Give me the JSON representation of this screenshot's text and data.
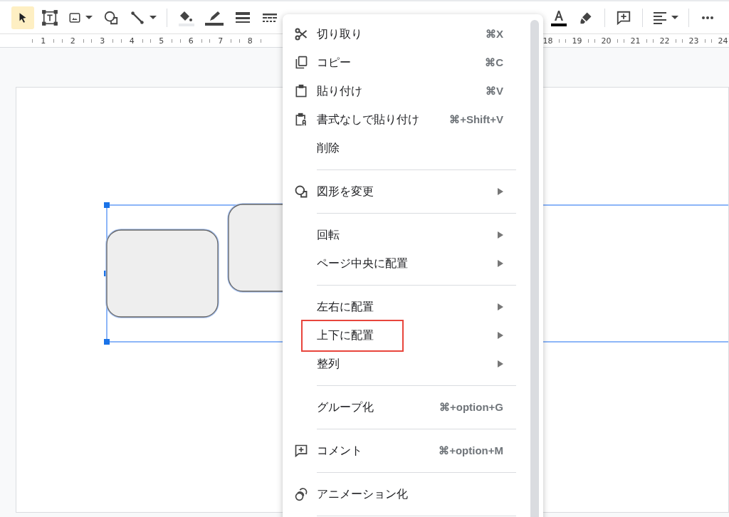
{
  "toolbar": {
    "tools": [
      {
        "kind": "select",
        "selected": true
      },
      {
        "kind": "textbox",
        "selected": false
      },
      {
        "kind": "image",
        "selected": false
      },
      {
        "kind": "shape",
        "selected": false
      },
      {
        "kind": "line",
        "selected": false
      },
      {
        "kind": "divider"
      },
      {
        "kind": "fill",
        "selected": false
      },
      {
        "kind": "border-color",
        "selected": false
      },
      {
        "kind": "border-weight",
        "selected": false
      },
      {
        "kind": "border-dash",
        "selected": false
      }
    ],
    "right_tools": [
      {
        "kind": "text-color",
        "selected": false
      },
      {
        "kind": "highlight",
        "selected": false
      },
      {
        "kind": "divider"
      },
      {
        "kind": "comment",
        "selected": false
      },
      {
        "kind": "divider"
      },
      {
        "kind": "align",
        "selected": false
      },
      {
        "kind": "divider"
      },
      {
        "kind": "more",
        "selected": false
      }
    ]
  },
  "ruler": {
    "left_numbers": [
      "1",
      "2",
      "3",
      "4",
      "5",
      "6",
      "7",
      "8"
    ],
    "right_numbers": [
      "18",
      "19",
      "20",
      "21",
      "22",
      "23",
      "24"
    ]
  },
  "slide": {
    "shapes": [
      {
        "kind": "rounded-rect",
        "selected": true
      },
      {
        "kind": "rounded-rect",
        "selected": true
      }
    ]
  },
  "context_menu": {
    "items": [
      {
        "kind": "item",
        "label": "切り取り",
        "shortcut": "⌘X",
        "submenu": false,
        "highlighted": false
      },
      {
        "kind": "item",
        "label": "コピー",
        "shortcut": "⌘C",
        "submenu": false,
        "highlighted": false
      },
      {
        "kind": "item",
        "label": "貼り付け",
        "shortcut": "⌘V",
        "submenu": false,
        "highlighted": false
      },
      {
        "kind": "item",
        "label": "書式なしで貼り付け",
        "shortcut": "⌘+Shift+V",
        "submenu": false,
        "highlighted": false
      },
      {
        "kind": "item",
        "label": "削除",
        "submenu": false,
        "highlighted": false
      },
      {
        "kind": "separator"
      },
      {
        "kind": "item",
        "label": "図形を変更",
        "submenu": true,
        "highlighted": false
      },
      {
        "kind": "separator"
      },
      {
        "kind": "item",
        "label": "回転",
        "submenu": true,
        "highlighted": false
      },
      {
        "kind": "item",
        "label": "ページ中央に配置",
        "submenu": true,
        "highlighted": false
      },
      {
        "kind": "separator"
      },
      {
        "kind": "item",
        "label": "左右に配置",
        "submenu": true,
        "highlighted": false
      },
      {
        "kind": "item",
        "label": "上下に配置",
        "submenu": true,
        "highlighted": true
      },
      {
        "kind": "item",
        "label": "整列",
        "submenu": true,
        "highlighted": false
      },
      {
        "kind": "separator"
      },
      {
        "kind": "item",
        "label": "グループ化",
        "shortcut": "⌘+option+G",
        "submenu": false,
        "highlighted": false
      },
      {
        "kind": "separator"
      },
      {
        "kind": "item",
        "label": "コメント",
        "shortcut": "⌘+option+M",
        "submenu": false,
        "highlighted": false
      },
      {
        "kind": "separator"
      },
      {
        "kind": "item",
        "label": "アニメーション化",
        "submenu": false,
        "highlighted": false
      },
      {
        "kind": "separator"
      }
    ]
  }
}
